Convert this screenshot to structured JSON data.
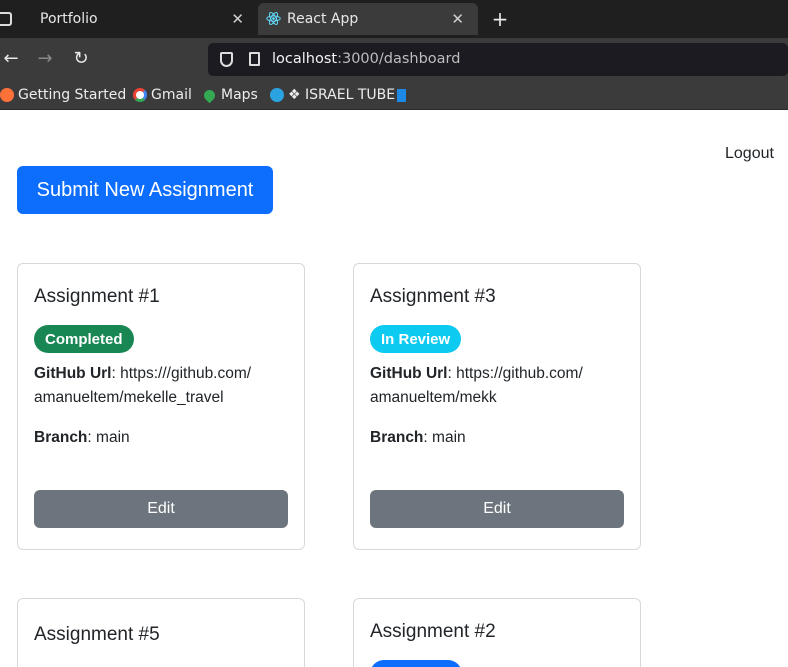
{
  "browser": {
    "tabs": [
      {
        "label": "Portfolio",
        "active": false
      },
      {
        "label": "React App",
        "active": true
      }
    ],
    "url_host": "localhost",
    "url_path": ":3000/dashboard",
    "bookmarks": [
      {
        "label": "Getting Started",
        "icon": "firefox-icon"
      },
      {
        "label": "Gmail",
        "icon": "google-icon"
      },
      {
        "label": "Maps",
        "icon": "maps-pin-icon"
      },
      {
        "label": "❖ ISRAEL TUBE",
        "icon": "telegram-icon"
      }
    ]
  },
  "page": {
    "logout_label": "Logout",
    "submit_label": "Submit New Assignment",
    "github_label": "GitHub Url",
    "branch_label": "Branch",
    "edit_label": "Edit",
    "colors": {
      "primary": "#0d6efd",
      "completed": "#198754",
      "in_review": "#0dcaf0",
      "secondary": "#6c757d"
    },
    "assignments": [
      {
        "title": "Assignment #1",
        "status": "Completed",
        "github_url_line1": "https:///github.com/",
        "github_url_line2": "amanueltem/mekelle_travel",
        "branch": "main"
      },
      {
        "title": "Assignment #3",
        "status": "In Review",
        "github_url_line1": "https://github.com/",
        "github_url_line2": "amanueltem/mekk",
        "branch": "main"
      },
      {
        "title": "Assignment #5"
      },
      {
        "title": "Assignment #2"
      }
    ]
  }
}
